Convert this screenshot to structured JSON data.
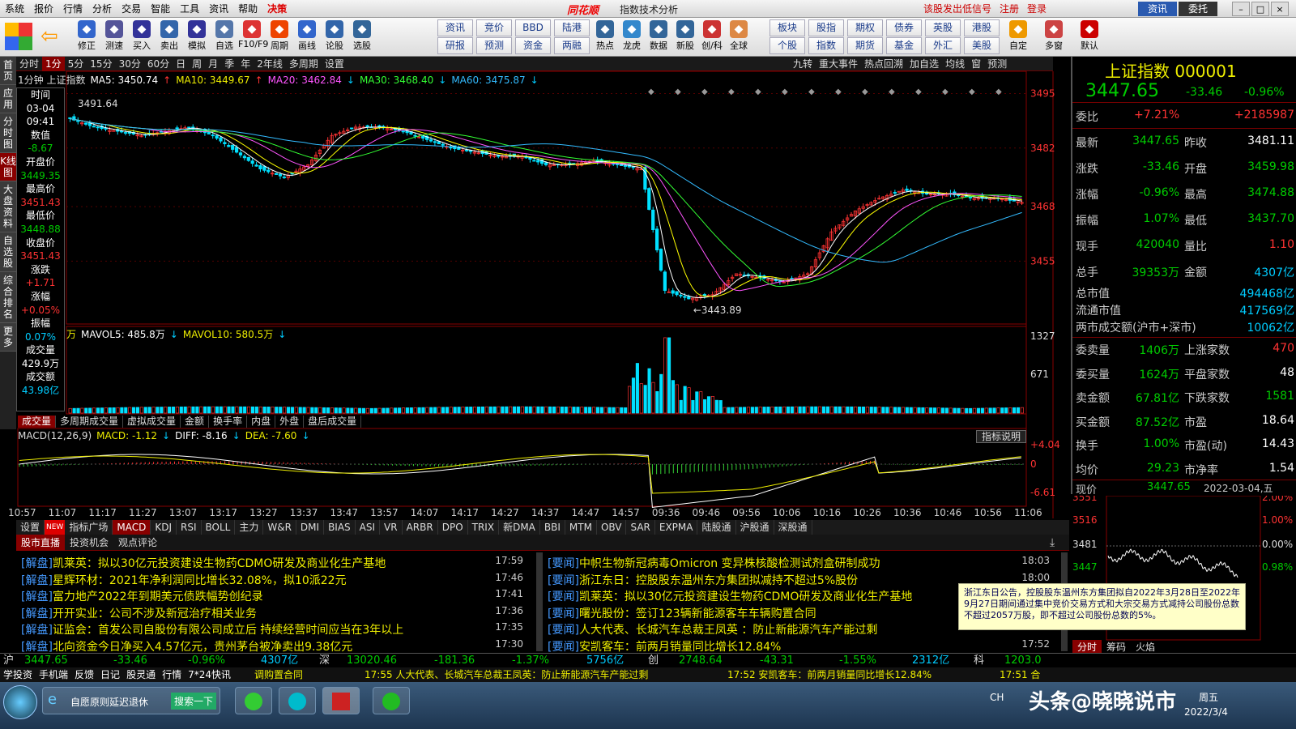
{
  "menu": {
    "items": [
      "系统",
      "报价",
      "行情",
      "分析",
      "交易",
      "智能",
      "工具",
      "资讯",
      "帮助",
      "决策"
    ],
    "logo": "同花顺",
    "title": "指数技术分析",
    "right_links": [
      "该股发出低信号",
      "注册",
      "登录"
    ],
    "zixun": "资讯",
    "weituo": "委托"
  },
  "toolbar": {
    "buttons": [
      "修正",
      "测速",
      "买入",
      "卖出",
      "模拟",
      "自选",
      "F10/F9",
      "周期",
      "画线",
      "论股",
      "选股"
    ],
    "grid": [
      [
        "资讯",
        "竞价",
        "BBD",
        "陆港"
      ],
      [
        "研报",
        "预测",
        "资金",
        "两融"
      ]
    ],
    "buttons2": [
      "热点",
      "龙虎",
      "数据",
      "新股",
      "创/科",
      "全球"
    ],
    "grid2": [
      [
        "板块",
        "股指",
        "期权",
        "债券",
        "英股",
        "港股"
      ],
      [
        "个股",
        "指数",
        "期货",
        "基金",
        "外汇",
        "美股"
      ]
    ],
    "buttons3": [
      "自定",
      "多窗",
      "默认"
    ]
  },
  "vtabs": [
    {
      "label": "首页",
      "active": false
    },
    {
      "label": "应用",
      "active": false
    },
    {
      "label": "分时图",
      "active": false
    },
    {
      "label": "K线图",
      "active": true
    },
    {
      "label": "大盘资料",
      "active": false
    },
    {
      "label": "自选股",
      "active": false
    },
    {
      "label": "综合排名",
      "active": false
    },
    {
      "label": "更多",
      "active": false
    }
  ],
  "periods": [
    {
      "label": "分时",
      "active": false
    },
    {
      "label": "1分",
      "active": true
    },
    {
      "label": "5分",
      "active": false
    },
    {
      "label": "15分",
      "active": false
    },
    {
      "label": "30分",
      "active": false
    },
    {
      "label": "60分",
      "active": false
    },
    {
      "label": "日",
      "active": false
    },
    {
      "label": "周",
      "active": false
    },
    {
      "label": "月",
      "active": false
    },
    {
      "label": "季",
      "active": false
    },
    {
      "label": "年",
      "active": false
    },
    {
      "label": "2年线",
      "active": false
    },
    {
      "label": "多周期",
      "active": false
    },
    {
      "label": "设置",
      "active": false
    }
  ],
  "rightbar": [
    "九转",
    "重大事件",
    "热点回溯",
    "加自选",
    "均线",
    "窗",
    "预测"
  ],
  "ma_line": {
    "prefix": "1分钟  上证指数",
    "ma5": "MA5: 3450.74",
    "ma10": "MA10: 3449.67",
    "ma20": "MA20: 3462.84",
    "ma30": "MA30: 3468.40",
    "ma60": "MA60: 3475.87"
  },
  "info": {
    "time_label": "时间",
    "date": "03-04",
    "time": "09:41",
    "value_label": "数值",
    "value": "-8.67",
    "open_label": "开盘价",
    "open": "3449.35",
    "high_label": "最高价",
    "high": "3451.43",
    "low_label": "最低价",
    "low": "3448.88",
    "close_label": "收盘价",
    "close": "3451.43",
    "chg_label": "涨跌",
    "chg": "+1.71",
    "pct_label": "涨幅",
    "pct": "+0.05%",
    "amp_label": "振幅",
    "amp": "0.07%",
    "vol_label": "成交量",
    "vol": "429.9万",
    "amt_label": "成交额",
    "amt": "43.98亿"
  },
  "chart_data": {
    "type": "candlestick",
    "price_axis": [
      "3495",
      "3482",
      "3468",
      "3455"
    ],
    "ylim": [
      3440,
      3498
    ],
    "high_label": "3491.64",
    "low_label": "3443.89",
    "vol_line": {
      "unit": "万",
      "mavol5": "MAVOL5: 485.8万",
      "mavol10": "MAVOL10: 580.5万"
    },
    "vol_axis": [
      "1327",
      "671"
    ],
    "vol_tabs": [
      "成交量",
      "多周期成交量",
      "虚拟成交量",
      "金额",
      "换手率",
      "内盘",
      "外盘",
      "盘后成交量"
    ],
    "macd_line": {
      "title": "MACD(12,26,9)",
      "macd": "MACD: -1.12",
      "diff": "DIFF: -8.16",
      "dea": "DEA: -7.60"
    },
    "macd_axis": [
      "+4.04",
      "0",
      "-6.61"
    ],
    "macd_btn": "指标说明",
    "time_axis": [
      "10:57",
      "11:07",
      "11:17",
      "11:27",
      "13:07",
      "13:17",
      "13:27",
      "13:37",
      "13:47",
      "13:57",
      "14:07",
      "14:17",
      "14:27",
      "14:37",
      "14:47",
      "14:57",
      "09:36",
      "09:46",
      "09:56",
      "10:06",
      "10:16",
      "10:26",
      "10:36",
      "10:46",
      "10:56",
      "11:06"
    ],
    "close_points": [
      3489,
      3487,
      3486,
      3485,
      3486,
      3487,
      3485,
      3481,
      3477,
      3475,
      3478,
      3485,
      3487,
      3487,
      3486,
      3484,
      3482,
      3481,
      3480,
      3480,
      3478,
      3478,
      3479,
      3478,
      3477,
      3448,
      3446,
      3447,
      3452,
      3451,
      3450,
      3452,
      3462,
      3467,
      3470,
      3472,
      3471,
      3471,
      3470,
      3470,
      3469
    ],
    "colors": {
      "up": "#ff3333",
      "down": "#00e0ff",
      "ma5": "#ffffff",
      "ma10": "#ffff00",
      "ma20": "#ff55ff",
      "ma30": "#33ff33",
      "ma60": "#33bbff"
    }
  },
  "indicator_tabs": [
    {
      "label": "设置",
      "active": false
    },
    {
      "label": "指标广场",
      "active": false
    },
    {
      "label": "MACD",
      "active": true
    },
    {
      "label": "KDJ",
      "active": false
    },
    {
      "label": "RSI",
      "active": false
    },
    {
      "label": "BOLL",
      "active": false
    },
    {
      "label": "主力",
      "active": false
    },
    {
      "label": "W&R",
      "active": false
    },
    {
      "label": "DMI",
      "active": false
    },
    {
      "label": "BIAS",
      "active": false
    },
    {
      "label": "ASI",
      "active": false
    },
    {
      "label": "VR",
      "active": false
    },
    {
      "label": "ARBR",
      "active": false
    },
    {
      "label": "DPO",
      "active": false
    },
    {
      "label": "TRIX",
      "active": false
    },
    {
      "label": "新DMA",
      "active": false
    },
    {
      "label": "BBI",
      "active": false
    },
    {
      "label": "MTM",
      "active": false
    },
    {
      "label": "OBV",
      "active": false
    },
    {
      "label": "SAR",
      "active": false
    },
    {
      "label": "EXPMA",
      "active": false
    },
    {
      "label": "陆股通",
      "active": false
    },
    {
      "label": "沪股通",
      "active": false
    },
    {
      "label": "深股通",
      "active": false
    }
  ],
  "new_badge": "NEW",
  "quote": {
    "name": "上证指数 000001",
    "price": "3447.65",
    "change": "-33.46",
    "pct": "-0.96%",
    "webi_label": "委比",
    "webi": "+7.21%",
    "webi_diff": "+2185987",
    "rows": [
      {
        "k": "最新",
        "v1": "3447.65",
        "v1c": "grn",
        "k2": "昨收",
        "v2": "3481.11",
        "v2c": "wht"
      },
      {
        "k": "涨跌",
        "v1": "-33.46",
        "v1c": "grn",
        "k2": "开盘",
        "v2": "3459.98",
        "v2c": "grn"
      },
      {
        "k": "涨幅",
        "v1": "-0.96%",
        "v1c": "grn",
        "k2": "最高",
        "v2": "3474.88",
        "v2c": "grn"
      },
      {
        "k": "振幅",
        "v1": "1.07%",
        "v1c": "grn",
        "k2": "最低",
        "v2": "3437.70",
        "v2c": "grn"
      },
      {
        "k": "现手",
        "v1": "420040",
        "v1c": "grn",
        "k2": "量比",
        "v2": "1.10",
        "v2c": "red"
      },
      {
        "k": "总手",
        "v1": "39353万",
        "v1c": "wht",
        "k2": "金额",
        "v2": "4307亿",
        "v2c": "cyan"
      }
    ],
    "caps": [
      {
        "k": "总市值",
        "v": "494468亿"
      },
      {
        "k": "流通市值",
        "v": "417569亿"
      },
      {
        "k": "两市成交额(沪市+深市)",
        "v": "10062亿"
      }
    ],
    "rows2": [
      {
        "k": "委卖量",
        "v1": "1406万",
        "v1c": "grn",
        "k2": "上涨家数",
        "v2": "470",
        "v2c": "red"
      },
      {
        "k": "委买量",
        "v1": "1624万",
        "v1c": "red",
        "k2": "平盘家数",
        "v2": "48",
        "v2c": "wht"
      },
      {
        "k": "卖金额",
        "v1": "67.81亿",
        "v1c": "grn",
        "k2": "下跌家数",
        "v2": "1581",
        "v2c": "grn"
      },
      {
        "k": "买金额",
        "v1": "87.52亿",
        "v1c": "grn",
        "k2": "市盈",
        "v2": "18.64",
        "v2c": "wht"
      },
      {
        "k": "换手",
        "v1": "1.00%",
        "v1c": "grn",
        "k2": "市盈(动)",
        "v2": "14.43",
        "v2c": "wht"
      },
      {
        "k": "均价",
        "v1": "29.23",
        "v1c": "grn",
        "k2": "市净率",
        "v2": "1.54",
        "v2c": "wht"
      }
    ],
    "mini_label": "现价",
    "mini_price": "3447.65",
    "mini_date": "2022-03-04,五",
    "mini_axis_left": [
      "3551",
      "3516",
      "3481",
      "3447"
    ],
    "mini_axis_right": [
      "2.00%",
      "1.00%",
      "0.00%",
      "0.98%"
    ],
    "mini_tabs": [
      "分时",
      "筹码",
      "火焰"
    ]
  },
  "news_tabs": [
    {
      "label": "股市直播",
      "active": true
    },
    {
      "label": "投资机会",
      "active": false
    },
    {
      "label": "观点评论",
      "active": false
    }
  ],
  "news_left": [
    {
      "tag": "[解盘]",
      "text": "凯莱英：拟以30亿元投资建设生物药CDMO研发及商业化生产基地",
      "time": "17:59"
    },
    {
      "tag": "[解盘]",
      "text": "星辉环材：2021年净利润同比增长32.08%，拟10派22元",
      "time": "17:46"
    },
    {
      "tag": "[解盘]",
      "text": "富力地产2022年到期美元债跌幅势创纪录",
      "time": "17:41"
    },
    {
      "tag": "[解盘]",
      "text": "开开实业：公司不涉及新冠治疗相关业务",
      "time": "17:36"
    },
    {
      "tag": "[解盘]",
      "text": "证监会：首发公司自股份有限公司成立后 持续经营时间应当在3年以上",
      "time": "17:35"
    },
    {
      "tag": "[解盘]",
      "text": "北向资金今日净买入4.57亿元，贵州茅台被净卖出9.38亿元",
      "time": "17:30"
    }
  ],
  "news_right": [
    {
      "tag": "[要闻]",
      "text": "中帜生物新冠病毒Omicron 变异株核酸检测试剂盒研制成功",
      "time": "18:03"
    },
    {
      "tag": "[要闻]",
      "text": "浙江东日：控股股东温州东方集团拟减持不超过5%股份",
      "time": "18:00"
    },
    {
      "tag": "[要闻]",
      "text": "凯莱英：拟以30亿元投资建设生物药CDMO研发及商业化生产基地",
      "time": ""
    },
    {
      "tag": "[要闻]",
      "text": "曙光股份：签订123辆新能源客车车辆购置合同",
      "time": ""
    },
    {
      "tag": "[要闻]",
      "text": "人大代表、长城汽车总裁王凤英 ：防止新能源汽车产能过剩",
      "time": ""
    },
    {
      "tag": "[要闻]",
      "text": "安凯客车：前两月销量同比增长12.84%",
      "time": "17:52"
    }
  ],
  "popup_text": "浙江东日公告，控股股东温州东方集团拟自2022年3月28日至2022年9月27日期间通过集中竞价交易方式和大宗交易方式减持公司股份总数不超过2057万股，即不超过公司股份总数的5%。",
  "ticker": {
    "sh_label": "沪",
    "sh_price": "3447.65",
    "sh_chg": "-33.46",
    "sh_pct": "-0.96%",
    "sh_amt": "4307亿",
    "sz_label": "深",
    "sz_price": "13020.46",
    "sz_chg": "-181.36",
    "sz_pct": "-1.37%",
    "sz_amt": "5756亿",
    "cy_label": "创",
    "cy_price": "2748.64",
    "cy_chg": "-43.31",
    "cy_pct": "-1.55%",
    "cy_amt": "2312亿",
    "kc_label": "科",
    "kc_price": "1203.0"
  },
  "botrow": {
    "items": [
      "学投资",
      "手机端",
      "反馈",
      "日记",
      "股灵通",
      "行情",
      "7*24快讯"
    ],
    "scroll1": "调购置合同",
    "scroll2": "17:55 人大代表、长城汽车总裁王凤英：防止新能源汽车产能过剩",
    "scroll3": "17:52 安凯客车：前两月销量同比增长12.84%",
    "scroll4": "17:51 合"
  },
  "taskbar": {
    "ie_text": "自愿原则延迟退休",
    "search_btn": "搜索一下",
    "watermark": "头条@晓晓说市",
    "date": "2022/3/4",
    "day": "周五",
    "lang": "CH"
  }
}
